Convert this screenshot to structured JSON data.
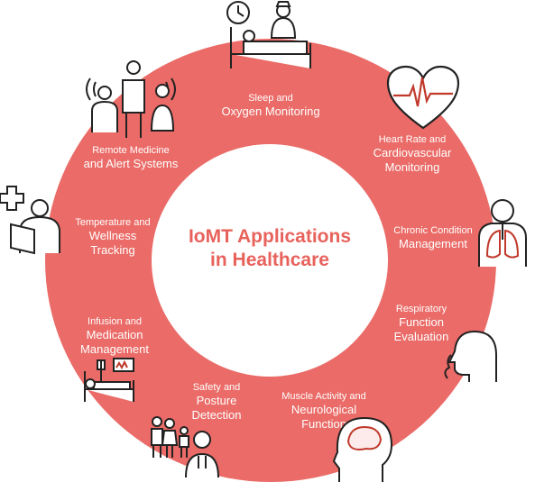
{
  "colors": {
    "ring": "#ea6b67",
    "title": "#e8625c",
    "label_text": "#ffffff",
    "icon_stroke": "#222222"
  },
  "center": {
    "line1": "IoMT Applications",
    "line2": "in Healthcare"
  },
  "segments": [
    {
      "id": "sleep",
      "line1": "Sleep and",
      "line2": "Oxygen Monitoring",
      "icon": "clock-nurse-bed-icon"
    },
    {
      "id": "heart",
      "line1": "Heart Rate and",
      "line2": "Cardiovascular",
      "line3": "Monitoring",
      "icon": "heart-ecg-icon"
    },
    {
      "id": "chronic",
      "line1": "Chronic Condition",
      "line2": "Management",
      "icon": "lungs-person-icon"
    },
    {
      "id": "respiratory",
      "line1": "Respiratory",
      "line2": "Function",
      "line3": "Evaluation",
      "icon": "breathing-head-icon"
    },
    {
      "id": "muscle",
      "line1": "Muscle Activity and",
      "line2": "Neurological",
      "line3": "Function",
      "icon": "brain-head-icon"
    },
    {
      "id": "safety",
      "line1": "Safety and",
      "line2": "Posture",
      "line3": "Detection",
      "icon": "family-doctor-icon"
    },
    {
      "id": "infusion",
      "line1": "Infusion and",
      "line2": "Medication",
      "line3": "Management",
      "icon": "hospital-bed-monitor-icon"
    },
    {
      "id": "temperature",
      "line1": "Temperature and",
      "line2": "Wellness",
      "line3": "Tracking",
      "icon": "patient-cross-icon"
    },
    {
      "id": "remote",
      "line1": "Remote Medicine",
      "line2": "and Alert Systems",
      "icon": "doctor-family-signal-icon"
    }
  ]
}
